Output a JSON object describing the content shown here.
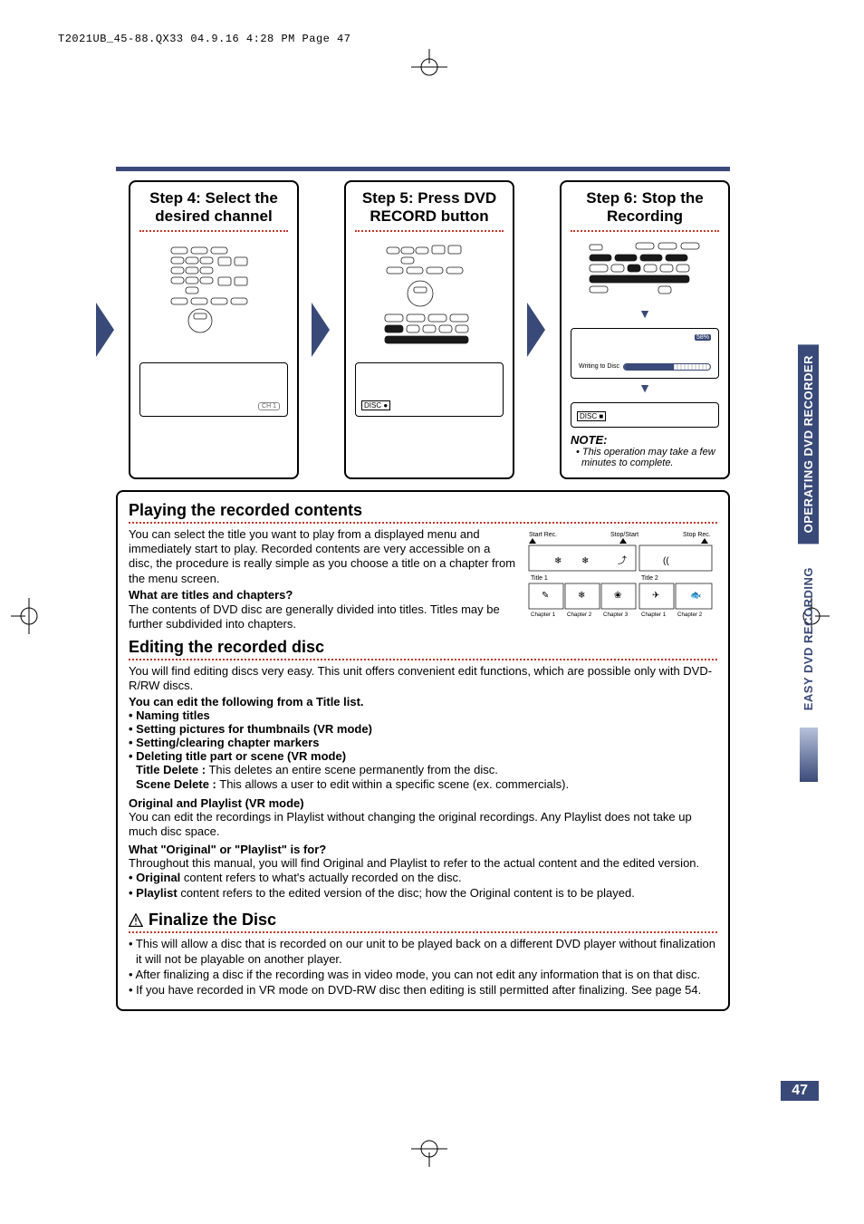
{
  "header": {
    "slug": "T2021UB_45-88.QX33  04.9.16  4:28 PM  Page 47"
  },
  "steps": {
    "s4": {
      "title": "Step 4: Select the desired channel",
      "osd": "CH 1"
    },
    "s5": {
      "title": "Step 5: Press DVD RECORD button",
      "osd": "DISC ●"
    },
    "s6": {
      "title": "Step 6: Stop the Recording",
      "progress_label": "Writing to Disc",
      "pct": "58%",
      "osd": "DISC ■",
      "note_heading": "NOTE:",
      "note_item": "• This operation may take a few minutes to complete."
    }
  },
  "playing": {
    "title": "Playing the recorded contents",
    "p1": "You can select the title you want to play from a displayed menu and immediately start to play. Recorded contents are very accessible on a disc, the procedure is really simple as you choose a title on a chapter from the menu screen.",
    "q": "What are titles and chapters?",
    "p2": "The contents of DVD disc are generally divided into titles. Titles may be further subdivided into chapters.",
    "diagram": {
      "start_rec": "Start Rec.",
      "stop_start": "Stop/Start",
      "stop_rec": "Stop Rec.",
      "title1": "Title 1",
      "title2": "Title 2",
      "ch1": "Chapter 1",
      "ch2": "Chapter 2",
      "ch3": "Chapter 3",
      "ch1b": "Chapter 1",
      "ch2b": "Chapter 2"
    }
  },
  "editing": {
    "title": "Editing the recorded disc",
    "p1": "You will find editing discs very easy. This unit offers convenient edit functions, which are possible only with DVD-R/RW discs.",
    "sub1": "You can edit the following from a Title list.",
    "b1": "• Naming titles",
    "b2": "• Setting pictures for thumbnails (VR mode)",
    "b3": "• Setting/clearing chapter markers",
    "b4": "• Deleting title part or scene (VR mode)",
    "td_label": "Title Delete :",
    "td_text": " This deletes an entire scene permanently from the disc.",
    "sd_label": "Scene Delete :",
    "sd_text": " This allows a user to edit within a specific scene (ex. commercials).",
    "sub2": "Original and Playlist (VR mode)",
    "p2": "You can edit the recordings in Playlist without changing the original recordings. Any Playlist does not take up much disc space.",
    "sub3": "What \"Original\" or \"Playlist\" is for?",
    "p3": "Throughout this manual, you will find Original and Playlist to refer to the actual content and the edited version.",
    "orig_label": "• Original",
    "orig_text": " content refers to what's actually recorded on the disc.",
    "pl_label": "• Playlist",
    "pl_text": " content refers to the edited version of the disc; how the Original content is to be played."
  },
  "finalize": {
    "title": "Finalize the Disc",
    "b1": "• This will allow a disc that is recorded on our unit to be played back on a different DVD player without finalization it will not be playable on another player.",
    "b2": "• After finalizing a disc if the recording was in video mode, you can not edit any information that is on that disc.",
    "b3": "• If you have recorded in VR mode on DVD-RW disc then editing is still permitted after finalizing. See page 54."
  },
  "tabs": {
    "active": "OPERATING DVD RECORDER",
    "ghost": "EASY DVD RECORDING"
  },
  "page_number": "47"
}
